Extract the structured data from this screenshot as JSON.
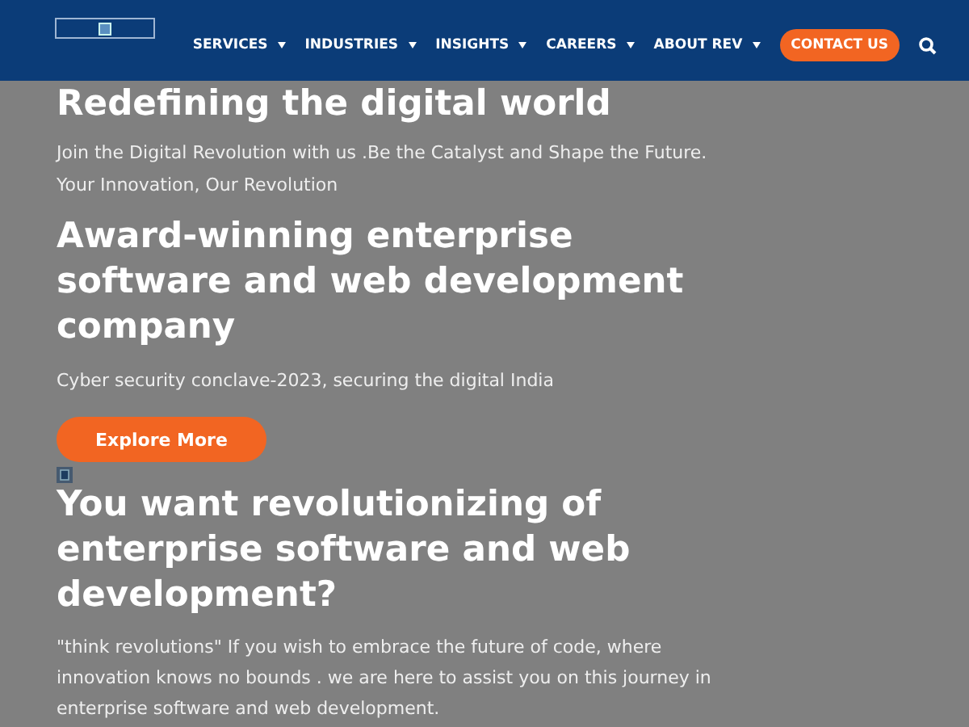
{
  "header": {
    "nav": [
      {
        "label": "SERVICES",
        "has_menu": true
      },
      {
        "label": "INDUSTRIES",
        "has_menu": true
      },
      {
        "label": "INSIGHTS",
        "has_menu": true
      },
      {
        "label": "CAREERS",
        "has_menu": true
      },
      {
        "label": "ABOUT REV",
        "has_menu": true
      }
    ],
    "contact": "CONTACT US"
  },
  "hero": {
    "title": "Redefining the digital world",
    "intro": "Join the Digital Revolution with us .Be the Catalyst and Shape the Future. Your Innovation, Our Revolution",
    "headline": "Award-winning enterprise software and web development company",
    "caption": "Cyber security conclave-2023, securing the digital India",
    "button": "Explore More"
  },
  "section": {
    "title": "You want revolutionizing of enterprise software and web development?",
    "text": "\"think revolutions\" If you wish to embrace the future of code, where innovation knows no bounds . we are here to assist you on this journey in enterprise software and web development."
  }
}
